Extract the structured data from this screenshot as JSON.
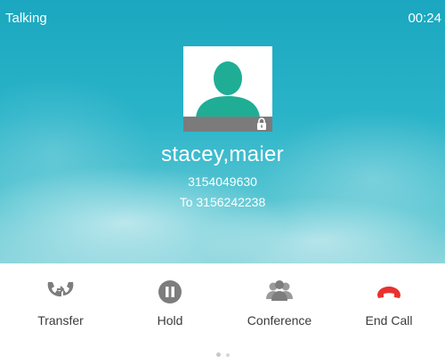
{
  "status": {
    "label": "Talking",
    "timer": "00:24"
  },
  "caller": {
    "name": "stacey,maier",
    "number": "3154049630",
    "dialed": "To 3156242238"
  },
  "softkeys": [
    {
      "label": "Transfer",
      "icon": "transfer-icon"
    },
    {
      "label": "Hold",
      "icon": "hold-icon"
    },
    {
      "label": "Conference",
      "icon": "conference-icon"
    },
    {
      "label": "End Call",
      "icon": "end-call-icon"
    }
  ],
  "pager": {
    "pages": 2,
    "current": 1
  },
  "colors": {
    "background_top": "#1aa7bf",
    "avatar_green": "#1fae95",
    "icon_gray": "#7d7d7d",
    "end_call_red": "#e8322e"
  }
}
